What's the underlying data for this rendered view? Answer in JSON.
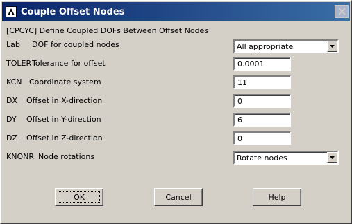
{
  "window": {
    "title": "Couple Offset Nodes",
    "header": "[CPCYC]  Define Coupled DOFs Between Offset Nodes"
  },
  "rows": [
    {
      "code": "Lab",
      "label": "DOF for coupled nodes",
      "value": "All appropriate",
      "type": "dropdown"
    },
    {
      "code": "TOLER",
      "label": "Tolerance for offset",
      "value": "0.0001",
      "type": "text"
    },
    {
      "code": "KCN",
      "label": "Coordinate system",
      "value": "11",
      "type": "text"
    },
    {
      "code": "DX",
      "label": "Offset in X-direction",
      "value": "0",
      "type": "text"
    },
    {
      "code": "DY",
      "label": "Offset in Y-direction",
      "value": "6",
      "type": "text"
    },
    {
      "code": "DZ",
      "label": "Offset in Z-direction",
      "value": "0",
      "type": "text"
    },
    {
      "code": "KNONR",
      "label": "Node rotations",
      "value": "Rotate nodes",
      "type": "dropdown"
    }
  ],
  "buttons": {
    "ok": "OK",
    "cancel": "Cancel",
    "help": "Help"
  },
  "colors": {
    "dialog_bg": "#d4d0c8",
    "title_bar": "#0a246a",
    "title_text": "#ffffff"
  },
  "icons": {
    "app": "ansys-logo-icon",
    "close": "close-icon",
    "dropdown": "chevron-down-icon"
  }
}
